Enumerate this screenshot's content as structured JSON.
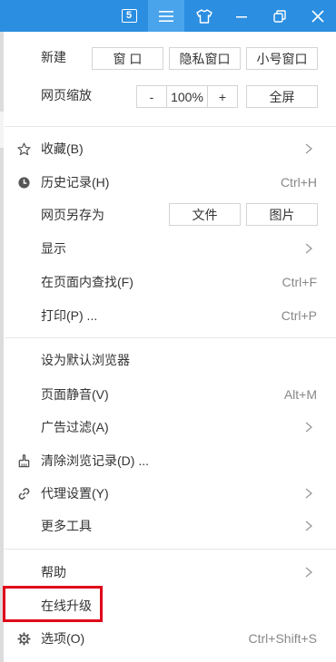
{
  "titlebar": {
    "tab_count": "5",
    "icons": [
      "tab-count-icon",
      "menu-icon",
      "skin-shirt-icon",
      "minimize-icon",
      "restore-icon",
      "close-icon"
    ]
  },
  "menu": {
    "new_label": "新建",
    "new_buttons": [
      "窗 口",
      "隐私窗口",
      "小号窗口"
    ],
    "zoom_label": "网页缩放",
    "zoom_minus": "-",
    "zoom_value": "100%",
    "zoom_plus": "+",
    "fullscreen": "全屏",
    "favorites": "收藏(B)",
    "history": "历史记录(H)",
    "history_shortcut": "Ctrl+H",
    "save_as": "网页另存为",
    "save_file": "文件",
    "save_image": "图片",
    "display": "显示",
    "find": "在页面内查找(F)",
    "find_shortcut": "Ctrl+F",
    "print": "打印(P) ...",
    "print_shortcut": "Ctrl+P",
    "set_default": "设为默认浏览器",
    "mute": "页面静音(V)",
    "mute_shortcut": "Alt+M",
    "ad_filter": "广告过滤(A)",
    "clear_history": "清除浏览记录(D) ...",
    "proxy": "代理设置(Y)",
    "more_tools": "更多工具",
    "help": "帮助",
    "upgrade": "在线升级",
    "options": "选项(O)",
    "options_shortcut": "Ctrl+Shift+S"
  },
  "colors": {
    "titlebar": "#2b8ee0",
    "titlebar_active": "#4aa4ec",
    "highlight_box": "#e0001a"
  }
}
